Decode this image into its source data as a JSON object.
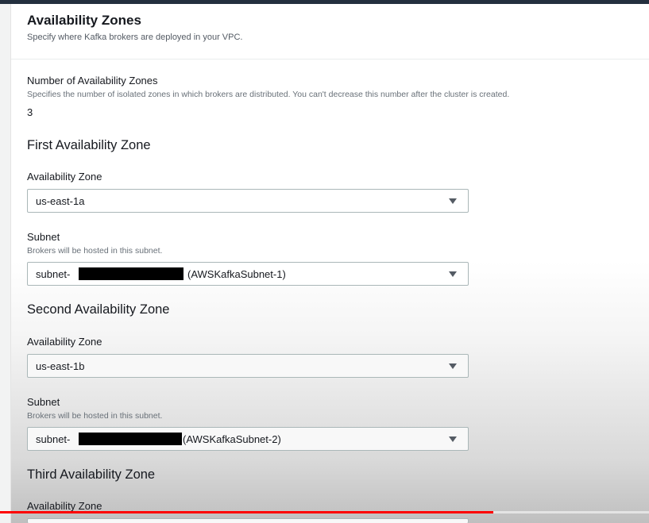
{
  "section": {
    "title": "Availability Zones",
    "description": "Specify where Kafka brokers are deployed in your VPC."
  },
  "az_count": {
    "label": "Number of Availability Zones",
    "description": "Specifies the number of isolated zones in which brokers are distributed. You can't decrease this number after the cluster is created.",
    "value": "3"
  },
  "zones": [
    {
      "heading": "First Availability Zone",
      "az_label": "Availability Zone",
      "az_value": "us-east-1a",
      "subnet_label": "Subnet",
      "subnet_description": "Brokers will be hosted in this subnet.",
      "subnet_prefix": "subnet-",
      "subnet_suffix": "(AWSKafkaSubnet-1)"
    },
    {
      "heading": "Second Availability Zone",
      "az_label": "Availability Zone",
      "az_value": "us-east-1b",
      "subnet_label": "Subnet",
      "subnet_description": "Brokers will be hosted in this subnet.",
      "subnet_prefix": "subnet-",
      "subnet_suffix": "(AWSKafkaSubnet-2)"
    },
    {
      "heading": "Third Availability Zone",
      "az_label": "Availability Zone"
    }
  ],
  "icons": {
    "dropdown": "caret-down-icon"
  },
  "video_progress": 0.76,
  "colors": {
    "progress": "#ff0000",
    "topbar": "#232f3e"
  }
}
